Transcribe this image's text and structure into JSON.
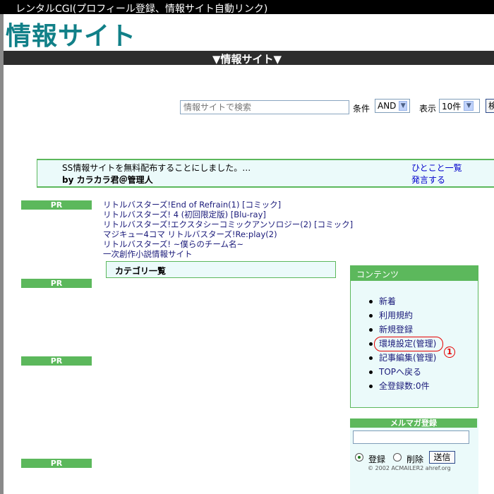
{
  "window_title": "レンタルCGI(プロフィール登録、情報サイト自動リンク)",
  "site_title": "情報サイト",
  "nav_label": "▼情報サイト▼",
  "search": {
    "placeholder": "情報サイトで検索",
    "condition_label": "条件",
    "condition_value": "AND",
    "display_label": "表示",
    "display_value": "10件",
    "button_label": "検"
  },
  "notice": {
    "text": "SS情報サイトを無料配布することにしました。…",
    "author": "by カラカラ君＠管理人",
    "link_list": "ひとこと一覧",
    "link_post": "発言する"
  },
  "pr_label": "PR",
  "pr_links": [
    "リトルバスターズ!End of Refrain(1) [コミック]",
    "リトルバスターズ! 4 (初回限定版) [Blu-ray]",
    "リトルバスターズ!エクスタシーコミックアンソロジー(2) [コミック]",
    "マジキュー4コマ リトルバスターズ!Re:play(2)",
    "リトルバスターズ! ~僕らのチーム名~",
    "一次創作小説情報サイト"
  ],
  "category_label": "カテゴリ一覧",
  "contents": {
    "header": "コンテンツ",
    "items": [
      "新着",
      "利用規約",
      "新規登録",
      "環境設定(管理)",
      "記事編集(管理)",
      "TOPへ戻る",
      "全登録数:0件"
    ],
    "annotation": "1"
  },
  "mailmag": {
    "header": "メルマガ登録",
    "radio_register": "登録",
    "radio_delete": "削除",
    "send_label": "送信",
    "copyright": "© 2002 ACMAILER2 ahref.org"
  },
  "colors": {
    "accent_green": "#5cb85c",
    "title_teal": "#118088",
    "panel_bg": "#ebfafa",
    "annotation_red": "#e60000"
  }
}
